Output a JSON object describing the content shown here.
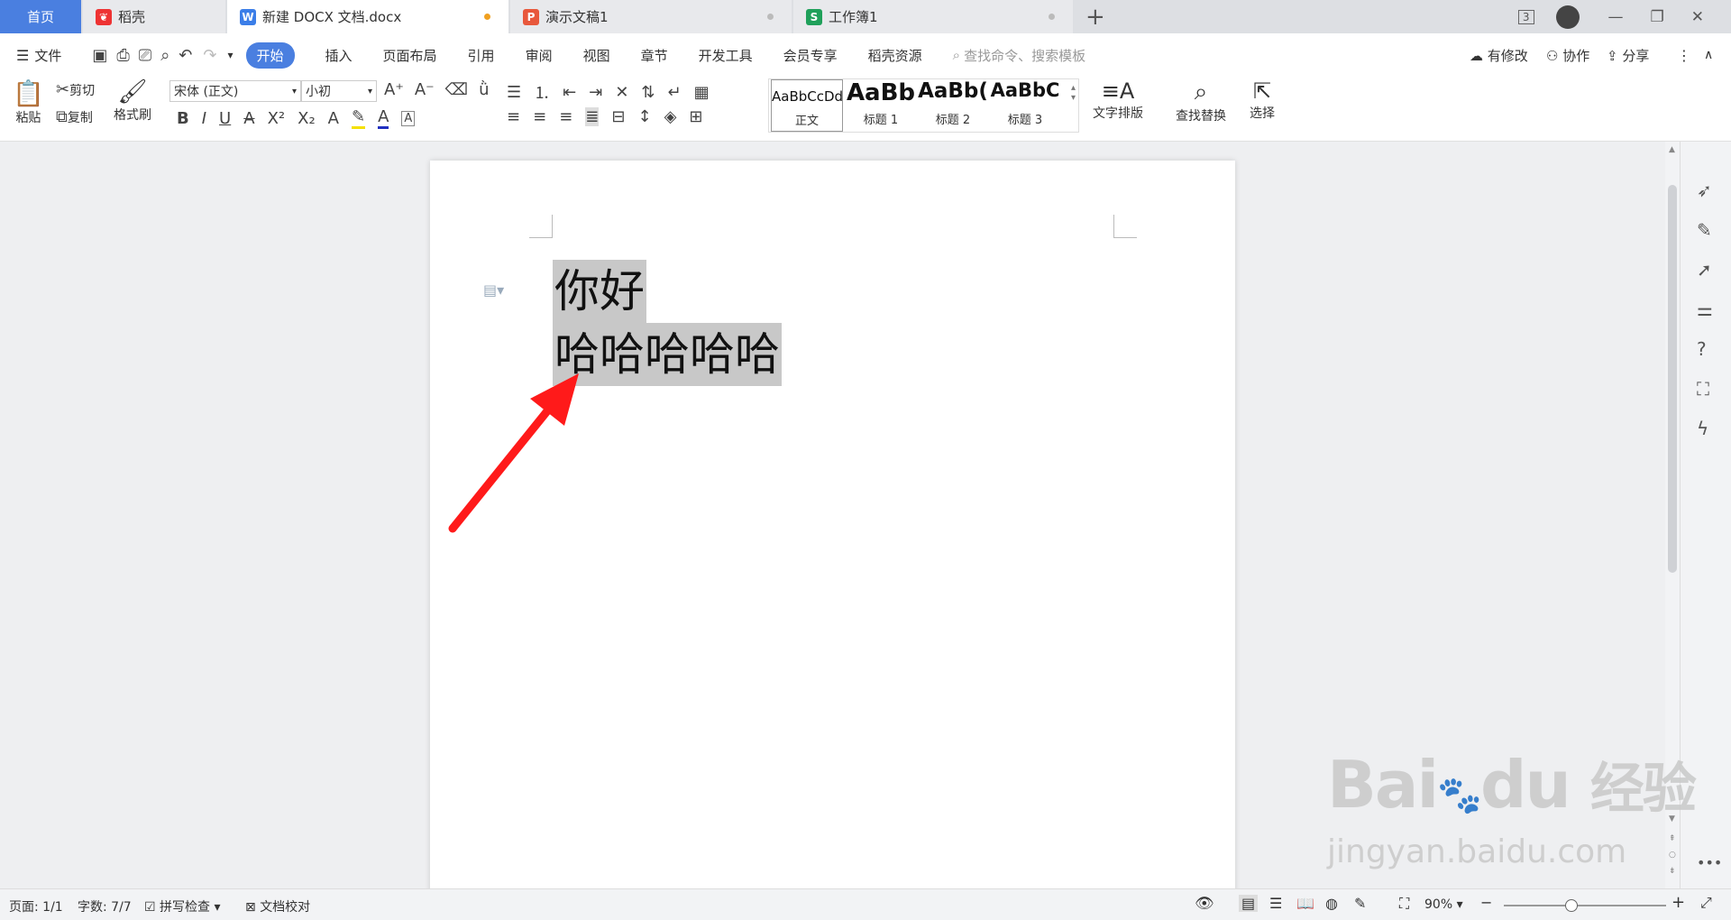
{
  "tabs": {
    "home": "首页",
    "docer": "稻壳",
    "doc": "新建 DOCX 文档.docx",
    "ppt": "演示文稿1",
    "xls": "工作簿1",
    "win_count": "3"
  },
  "menu": {
    "file": "文件",
    "items": [
      "开始",
      "插入",
      "页面布局",
      "引用",
      "审阅",
      "视图",
      "章节",
      "开发工具",
      "会员专享",
      "稻壳资源"
    ],
    "search_placeholder": "查找命令、搜索模板",
    "modified": "有修改",
    "collab": "协作",
    "share": "分享"
  },
  "ribbon": {
    "paste": "粘贴",
    "cut": "剪切",
    "copy": "复制",
    "format_painter": "格式刷",
    "font_name": "宋体 (正文)",
    "font_size": "小初",
    "styles": [
      {
        "preview": "AaBbCcDd",
        "label": "正文"
      },
      {
        "preview": "AaBb",
        "label": "标题 1"
      },
      {
        "preview": "AaBb(",
        "label": "标题 2"
      },
      {
        "preview": "AaBbC",
        "label": "标题 3"
      }
    ],
    "text_layout": "文字排版",
    "find_replace": "查找替换",
    "select": "选择"
  },
  "document": {
    "line1": "你好",
    "line2": "哈哈哈哈哈"
  },
  "status": {
    "page": "页面: 1/1",
    "words": "字数: 7/7",
    "spell": "拼写检查",
    "proof": "文档校对",
    "zoom": "90%"
  },
  "watermark": {
    "brand": "Bai",
    "brand2": "du",
    "cn": "经验",
    "url": "jingyan.baidu.com"
  },
  "colors": {
    "accent": "#4a7fe0",
    "arrow": "#ff1a1a",
    "selection": "#c8c8c8"
  }
}
